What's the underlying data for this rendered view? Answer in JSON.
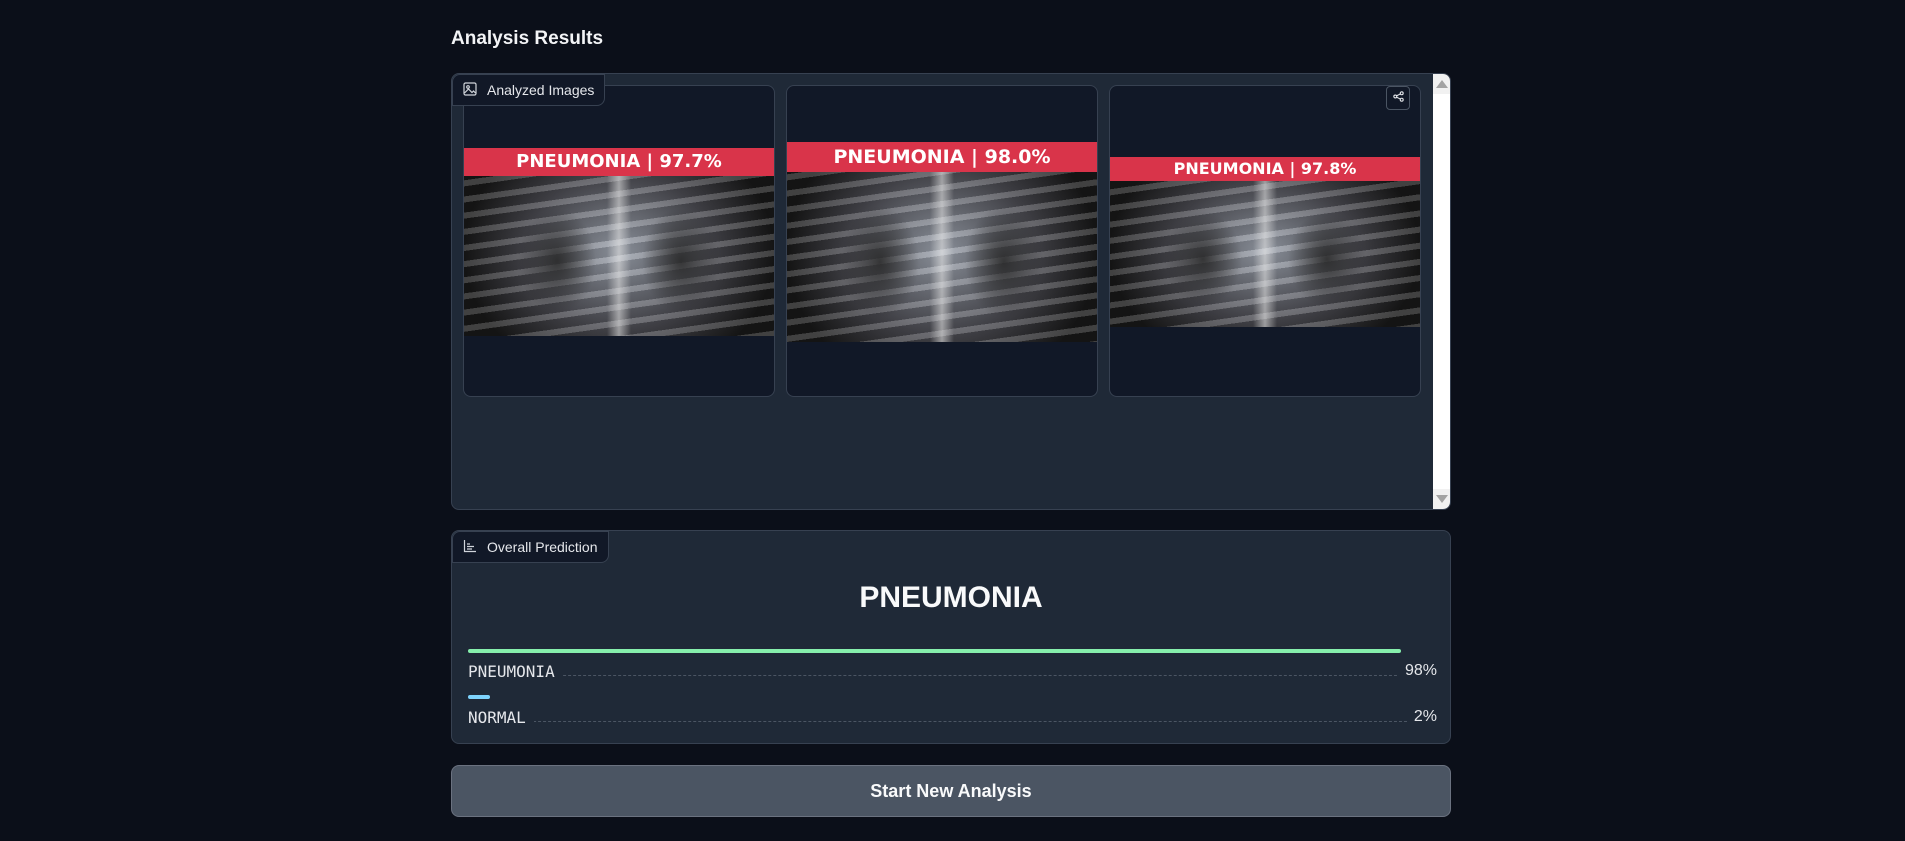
{
  "page": {
    "title": "Analysis Results"
  },
  "gallery": {
    "label": "Analyzed Images",
    "label_icon": "image-icon",
    "share_icon": "share-icon",
    "images": [
      {
        "banner": "PNEUMONIA | 97.7%"
      },
      {
        "banner": "PNEUMONIA | 98.0%"
      },
      {
        "banner": "PNEUMONIA | 97.8%"
      }
    ]
  },
  "prediction": {
    "label": "Overall Prediction",
    "label_icon": "bar-chart-icon",
    "result": "PNEUMONIA",
    "confidences": [
      {
        "name": "PNEUMONIA",
        "pct_text": "98%",
        "value": 0.98,
        "color": "#86efac"
      },
      {
        "name": "NORMAL",
        "pct_text": "2%",
        "value": 0.02,
        "color": "#7dd3fc"
      }
    ]
  },
  "actions": {
    "start_new": "Start New Analysis"
  },
  "colors": {
    "background": "#0b0f19",
    "panel": "#1f2937",
    "banner": "#d9344a",
    "button": "#4b5563"
  }
}
